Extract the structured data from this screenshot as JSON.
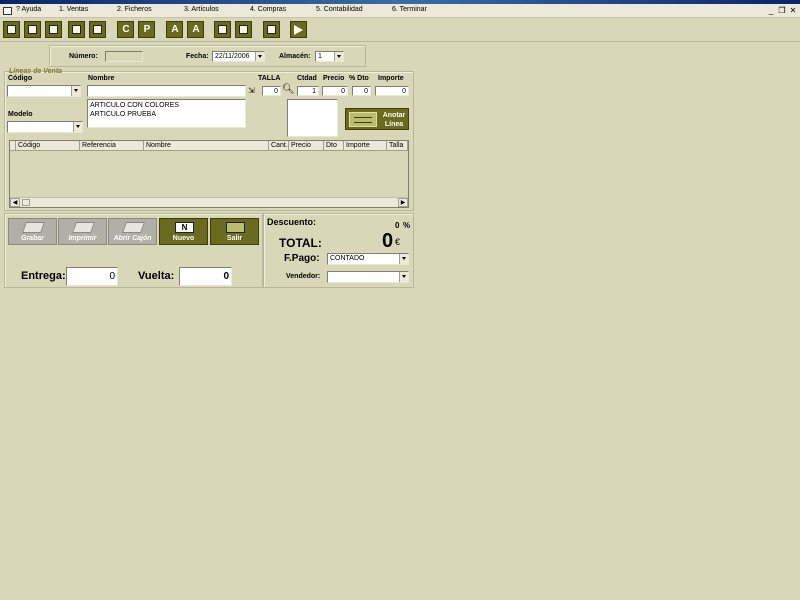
{
  "menu": {
    "items": [
      "? Ayuda",
      "1. Ventas",
      "2. Ficheros",
      "3. Artículos",
      "4. Compras",
      "5. Contabilidad",
      "6. Terminar"
    ]
  },
  "toolbar": {
    "icons": [
      "form-icon",
      "edit-form-icon",
      "document-icon",
      "list-icon",
      "calculator-icon"
    ],
    "c_label": "C",
    "p_label": "P",
    "a1_label": "A",
    "a2_label": "A",
    "next_icon": "arrow-right-icon"
  },
  "header": {
    "numero_label": "Número:",
    "numero_value": "",
    "fecha_label": "Fecha:",
    "fecha_value": "22/11/2006",
    "almacen_label": "Almacén:",
    "almacen_value": "1"
  },
  "lineas": {
    "legend": "Líneas de Venta",
    "codigo_label": "Código",
    "codigo_value": "",
    "nombre_label": "Nombre",
    "nombre_value": "",
    "modelo_label": "Modelo",
    "modelo_value": "",
    "talla_label": "TALLA",
    "talla_value": "0",
    "ctdad_label": "Ctdad",
    "ctdad_value": "1",
    "precio_label": "Precio",
    "precio_value": "0",
    "dto_label": "% Dto",
    "dto_value": "0",
    "importe_label": "Importe",
    "importe_value": "0",
    "suggestions": [
      "ARTICULO CON COLORES",
      "ARTICULO PRUEBA"
    ],
    "anotar_label_1": "Anotar",
    "anotar_label_2": "Línea"
  },
  "grid": {
    "columns": [
      "Código",
      "Referencia",
      "Nombre",
      "Cant.",
      "Precio",
      "Dto",
      "Importe",
      "Talla"
    ]
  },
  "actions": {
    "grabar": "Grabar",
    "imprimir": "Imprimir",
    "abrir_cajon": "Abrir Cajón",
    "nuevo": "Nuevo",
    "nuevo_icon_letter": "N",
    "salir": "Salir"
  },
  "totals": {
    "descuento_label": "Descuento:",
    "descuento_value": "0",
    "descuento_unit": "%",
    "total_label": "TOTAL:",
    "total_value": "0",
    "total_currency": "€",
    "fpago_label": "F.Pago:",
    "fpago_value": "CONTADO",
    "vendedor_label": "Vendedor:",
    "vendedor_value": ""
  },
  "payment": {
    "entrega_label": "Entrega:",
    "entrega_value": "0",
    "vuelta_label": "Vuelta:",
    "vuelta_value": "0"
  },
  "colors": {
    "background": "#d8d8b8",
    "accent": "#6b6b1f",
    "disabled_button": "#b0b0a8"
  }
}
